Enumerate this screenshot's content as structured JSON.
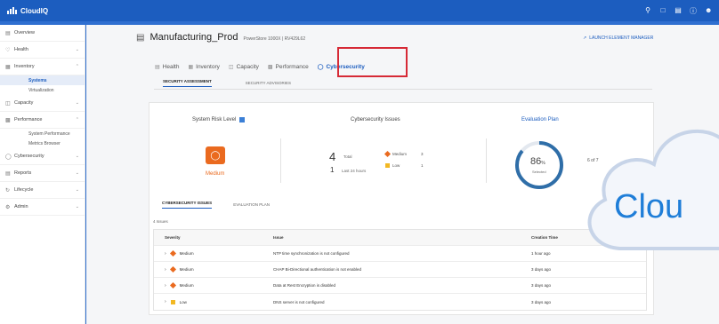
{
  "app": {
    "name": "CloudIQ",
    "top_icons": [
      "search-icon",
      "chat-icon",
      "list-icon",
      "help-icon",
      "user-icon"
    ]
  },
  "sidebar": {
    "items": [
      {
        "label": "Overview",
        "icon": "overview-icon",
        "chevron": ""
      },
      {
        "label": "Health",
        "icon": "health-icon",
        "chevron": "down"
      },
      {
        "label": "Inventory",
        "icon": "inventory-icon",
        "chevron": "up"
      },
      {
        "label": "Capacity",
        "icon": "capacity-icon",
        "chevron": "down"
      },
      {
        "label": "Performance",
        "icon": "performance-icon",
        "chevron": "up"
      },
      {
        "label": "Cybersecurity",
        "icon": "shield-icon",
        "chevron": "down"
      },
      {
        "label": "Reports",
        "icon": "reports-icon",
        "chevron": "down"
      },
      {
        "label": "Lifecycle",
        "icon": "lifecycle-icon",
        "chevron": "down"
      },
      {
        "label": "Admin",
        "icon": "admin-icon",
        "chevron": "down"
      }
    ],
    "inventory_sub": [
      "Systems",
      "Virtualization"
    ],
    "performance_sub": [
      "System Performance",
      "Metrics Browser"
    ],
    "active_sub": "Systems"
  },
  "header": {
    "title": "Manufacturing_Prod",
    "subtitle": "PowerStore 1000X | RV429L62",
    "launch": "LAUNCH ELEMENT MANAGER"
  },
  "tabs": [
    {
      "label": "Health",
      "active": false
    },
    {
      "label": "Inventory",
      "active": false
    },
    {
      "label": "Capacity",
      "active": false
    },
    {
      "label": "Performance",
      "active": false
    },
    {
      "label": "Cybersecurity",
      "active": true
    }
  ],
  "subtabs": [
    {
      "label": "SECURITY ASSESSMENT",
      "active": true
    },
    {
      "label": "SECURITY ADVISORIES",
      "active": false
    }
  ],
  "summary": {
    "risk_label": "System Risk Level",
    "risk_value": "Medium",
    "issues_label": "Cybersecurity Issues",
    "total_num": "4",
    "total_lbl": "Total",
    "last_num": "1",
    "last_lbl": "Last 24 hours",
    "medium_lbl": "Medium",
    "medium_cnt": "3",
    "low_lbl": "Low",
    "low_cnt": "1",
    "eval_label": "Evaluation Plan",
    "eval_pct_num": "86",
    "eval_pct_sign": "%",
    "eval_selected": "Selected",
    "eval_progress": 0.86,
    "of_text": "6 of 7"
  },
  "inner_tabs": [
    {
      "label": "CYBERSECURITY ISSUES",
      "active": true
    },
    {
      "label": "EVALUATION PLAN",
      "active": false
    }
  ],
  "issues": {
    "count_label": "4 Issues",
    "headers": {
      "severity": "Severity",
      "issue": "Issue",
      "time": "Creation Time"
    },
    "rows": [
      {
        "severity": "Medium",
        "issue": "NTP time synchronization is not configured",
        "time": "1 hour ago"
      },
      {
        "severity": "Medium",
        "issue": "CHAP Bi-Directional authentication is not enabled",
        "time": "3 days ago"
      },
      {
        "severity": "Medium",
        "issue": "Data at Rest Encryption is disabled",
        "time": "3 days ago"
      },
      {
        "severity": "Low",
        "issue": "DNS server is not configured",
        "time": "3 days ago"
      }
    ]
  },
  "overlay": {
    "cloud_text": "Clou"
  },
  "colors": {
    "brand": "#1c5dbf",
    "medium": "#ea6a1f",
    "low": "#f2b823",
    "highlight": "#d62a36"
  }
}
